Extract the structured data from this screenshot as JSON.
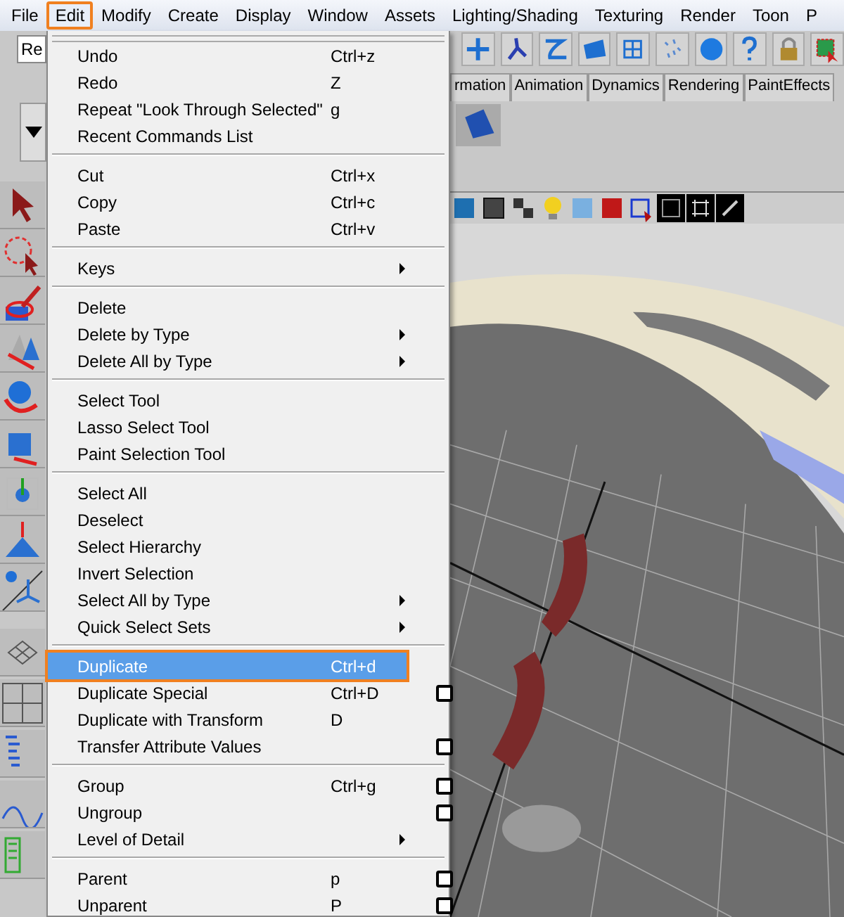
{
  "menubar": [
    {
      "label": "File",
      "selected": false
    },
    {
      "label": "Edit",
      "selected": true
    },
    {
      "label": "Modify",
      "selected": false
    },
    {
      "label": "Create",
      "selected": false
    },
    {
      "label": "Display",
      "selected": false
    },
    {
      "label": "Window",
      "selected": false
    },
    {
      "label": "Assets",
      "selected": false
    },
    {
      "label": "Lighting/Shading",
      "selected": false
    },
    {
      "label": "Texturing",
      "selected": false
    },
    {
      "label": "Render",
      "selected": false
    },
    {
      "label": "Toon",
      "selected": false
    },
    {
      "label": "P",
      "selected": false
    }
  ],
  "render_field": {
    "value": "Re"
  },
  "shelf_tabs": [
    "rmation",
    "Animation",
    "Dynamics",
    "Rendering",
    "PaintEffects"
  ],
  "edit_menu": {
    "sections": [
      [
        {
          "label": "Undo",
          "shortcut": "Ctrl+z",
          "submenu": false,
          "option_box": false,
          "selected": false
        },
        {
          "label": "Redo",
          "shortcut": "Z",
          "submenu": false,
          "option_box": false,
          "selected": false
        },
        {
          "label": "Repeat \"Look Through Selected\"",
          "shortcut": "g",
          "submenu": false,
          "option_box": false,
          "selected": false
        },
        {
          "label": "Recent Commands List",
          "submenu": false,
          "option_box": false,
          "selected": false
        }
      ],
      [
        {
          "label": "Cut",
          "shortcut": "Ctrl+x",
          "submenu": false,
          "option_box": false,
          "selected": false
        },
        {
          "label": "Copy",
          "shortcut": "Ctrl+c",
          "submenu": false,
          "option_box": false,
          "selected": false
        },
        {
          "label": "Paste",
          "shortcut": "Ctrl+v",
          "submenu": false,
          "option_box": false,
          "selected": false
        }
      ],
      [
        {
          "label": "Keys",
          "submenu": true,
          "option_box": false,
          "selected": false
        }
      ],
      [
        {
          "label": "Delete",
          "submenu": false,
          "option_box": false,
          "selected": false
        },
        {
          "label": "Delete by Type",
          "submenu": true,
          "option_box": false,
          "selected": false
        },
        {
          "label": "Delete All by Type",
          "submenu": true,
          "option_box": false,
          "selected": false
        }
      ],
      [
        {
          "label": "Select Tool",
          "submenu": false,
          "option_box": false,
          "selected": false
        },
        {
          "label": "Lasso Select Tool",
          "submenu": false,
          "option_box": false,
          "selected": false
        },
        {
          "label": "Paint Selection Tool",
          "submenu": false,
          "option_box": false,
          "selected": false
        }
      ],
      [
        {
          "label": "Select All",
          "submenu": false,
          "option_box": false,
          "selected": false
        },
        {
          "label": "Deselect",
          "submenu": false,
          "option_box": false,
          "selected": false
        },
        {
          "label": "Select Hierarchy",
          "submenu": false,
          "option_box": false,
          "selected": false
        },
        {
          "label": "Invert Selection",
          "submenu": false,
          "option_box": false,
          "selected": false
        },
        {
          "label": "Select All by Type",
          "submenu": true,
          "option_box": false,
          "selected": false
        },
        {
          "label": "Quick Select Sets",
          "submenu": true,
          "option_box": false,
          "selected": false
        }
      ],
      [
        {
          "label": "Duplicate",
          "shortcut": "Ctrl+d",
          "submenu": false,
          "option_box": false,
          "selected": true
        },
        {
          "label": "Duplicate Special",
          "shortcut": "Ctrl+D",
          "submenu": false,
          "option_box": true,
          "selected": false
        },
        {
          "label": "Duplicate with Transform",
          "shortcut": "D",
          "submenu": false,
          "option_box": false,
          "selected": false
        },
        {
          "label": "Transfer Attribute Values",
          "submenu": false,
          "option_box": true,
          "selected": false
        }
      ],
      [
        {
          "label": "Group",
          "shortcut": "Ctrl+g",
          "submenu": false,
          "option_box": true,
          "selected": false
        },
        {
          "label": "Ungroup",
          "submenu": false,
          "option_box": true,
          "selected": false
        },
        {
          "label": "Level of Detail",
          "submenu": true,
          "option_box": false,
          "selected": false
        }
      ],
      [
        {
          "label": "Parent",
          "shortcut": "p",
          "submenu": false,
          "option_box": true,
          "selected": false
        },
        {
          "label": "Unparent",
          "shortcut": "P",
          "submenu": false,
          "option_box": true,
          "selected": false
        }
      ]
    ]
  },
  "viewport": {
    "kind": "picture"
  }
}
